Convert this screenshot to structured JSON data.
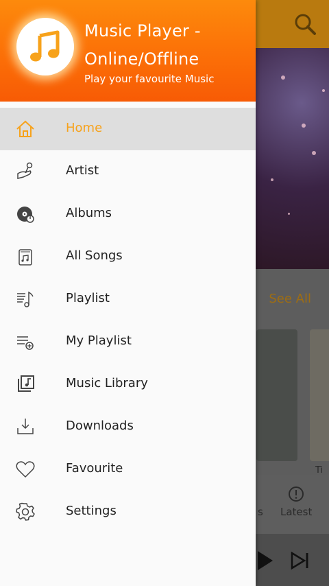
{
  "app": {
    "title": "Music Player - Online/Offline",
    "subtitle": "Play your favourite Music",
    "accent_color": "#f7a21b",
    "header_color": "#fb6d07"
  },
  "drawer": {
    "items": [
      {
        "label": "Home",
        "icon": "home-icon",
        "active": true
      },
      {
        "label": "Artist",
        "icon": "microphone-hand-icon",
        "active": false
      },
      {
        "label": "Albums",
        "icon": "vinyl-record-icon",
        "active": false
      },
      {
        "label": "All Songs",
        "icon": "song-folder-icon",
        "active": false
      },
      {
        "label": "Playlist",
        "icon": "playlist-icon",
        "active": false
      },
      {
        "label": "My Playlist",
        "icon": "playlist-add-icon",
        "active": false
      },
      {
        "label": "Music Library",
        "icon": "music-library-icon",
        "active": false
      },
      {
        "label": "Downloads",
        "icon": "download-icon",
        "active": false
      },
      {
        "label": "Favourite",
        "icon": "heart-icon",
        "active": false
      },
      {
        "label": "Settings",
        "icon": "gear-icon",
        "active": false
      }
    ]
  },
  "background": {
    "see_all": "See All",
    "card_caption": "Ti",
    "bottom_nav": {
      "partial_label": "s",
      "latest_label": "Latest"
    }
  }
}
